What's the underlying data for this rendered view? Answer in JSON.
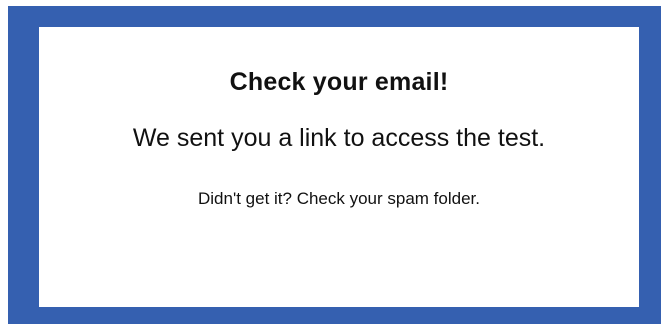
{
  "notice": {
    "title": "Check your email!",
    "message": "We sent you a link to access the test.",
    "hint": "Didn't get it? Check your spam folder."
  },
  "colors": {
    "frame_border": "#3560b0",
    "card_background": "#ffffff",
    "text": "#111111"
  }
}
